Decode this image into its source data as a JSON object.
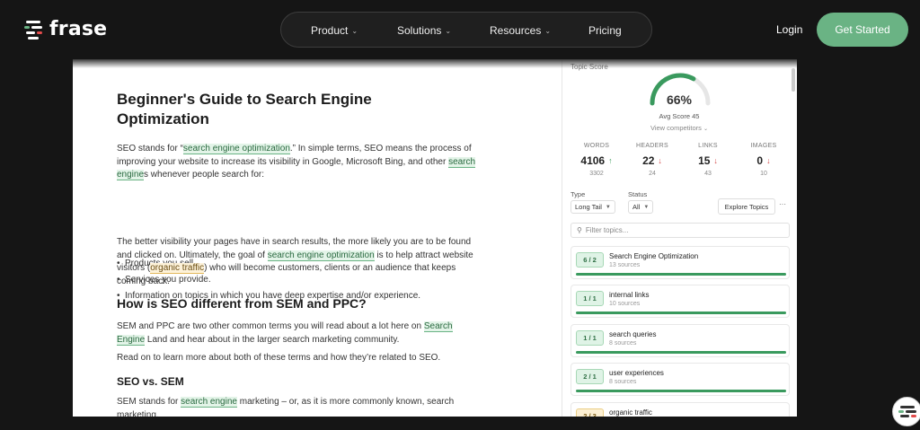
{
  "brand": {
    "name": "frase"
  },
  "nav": {
    "items": [
      {
        "label": "Product",
        "has_dropdown": true
      },
      {
        "label": "Solutions",
        "has_dropdown": true
      },
      {
        "label": "Resources",
        "has_dropdown": true
      },
      {
        "label": "Pricing",
        "has_dropdown": false
      }
    ],
    "login": "Login",
    "cta": "Get Started"
  },
  "article": {
    "title": "Beginner's Guide to Search Engine Optimization",
    "p1": {
      "a": "SEO stands for “",
      "hl1": "search engine optimization",
      "b": ".” In simple terms, SEO means the process of improving your website to increase its visibility in Google, Microsoft Bing, and other ",
      "hl2": "search engine",
      "c": "s whenever people search for:"
    },
    "bullets": [
      "Products you sell.",
      "Services you provide.",
      "Information on topics in which you have deep expertise and/or experience."
    ],
    "p2": {
      "a": "The better visibility your pages have in search results, the more likely you are to be found and clicked on. Ultimately, the goal of ",
      "hl1": "search engine optimization",
      "b": " is to help attract website visitors (",
      "hl2": "organic traffic",
      "c": ") who will become customers, clients or an audience that keeps coming back."
    },
    "h2": "How is SEO different from SEM and PPC?",
    "p3": {
      "a": "SEM and PPC are two other common terms you will read about a lot here on ",
      "hl1": "Search Engine",
      "b": " Land and hear about in the larger search marketing community."
    },
    "p4": "Read on to learn more about both of these terms and how they’re related to SEO.",
    "h3": "SEO vs. SEM",
    "p5": {
      "a": "SEM stands for ",
      "hl1": "search engine",
      "b": " marketing – or, as it is more commonly known, search marketing."
    }
  },
  "panel": {
    "topic_score_label": "Topic Score",
    "score": "66%",
    "score_value": 66,
    "avg_score": "Avg Score 45",
    "view_competitors": "View competitors",
    "stats": [
      {
        "label": "WORDS",
        "value": "4106",
        "trend": "up",
        "sub": "3302"
      },
      {
        "label": "HEADERS",
        "value": "22",
        "trend": "down",
        "sub": "24"
      },
      {
        "label": "LINKS",
        "value": "15",
        "trend": "down",
        "sub": "43"
      },
      {
        "label": "IMAGES",
        "value": "0",
        "trend": "down",
        "sub": "10"
      }
    ],
    "type_label": "Type",
    "type_value": "Long Tail",
    "status_label": "Status",
    "status_value": "All",
    "explore": "Explore Topics",
    "more": "···",
    "filter_placeholder": "Filter topics...",
    "topics": [
      {
        "badge": "6 / 2",
        "name": "Search Engine Optimization",
        "sources": "13 sources",
        "status": "ok"
      },
      {
        "badge": "1 / 1",
        "name": "internal links",
        "sources": "10 sources",
        "status": "ok"
      },
      {
        "badge": "1 / 1",
        "name": "search queries",
        "sources": "8 sources",
        "status": "ok"
      },
      {
        "badge": "2 / 1",
        "name": "user experiences",
        "sources": "8 sources",
        "status": "ok"
      },
      {
        "badge": "2 / 3",
        "name": "organic traffic",
        "sources": "",
        "status": "warn"
      }
    ]
  },
  "colors": {
    "accent": "#6ab384",
    "bar": "#3a9a5e",
    "gauge_track": "#e6e6e6"
  }
}
